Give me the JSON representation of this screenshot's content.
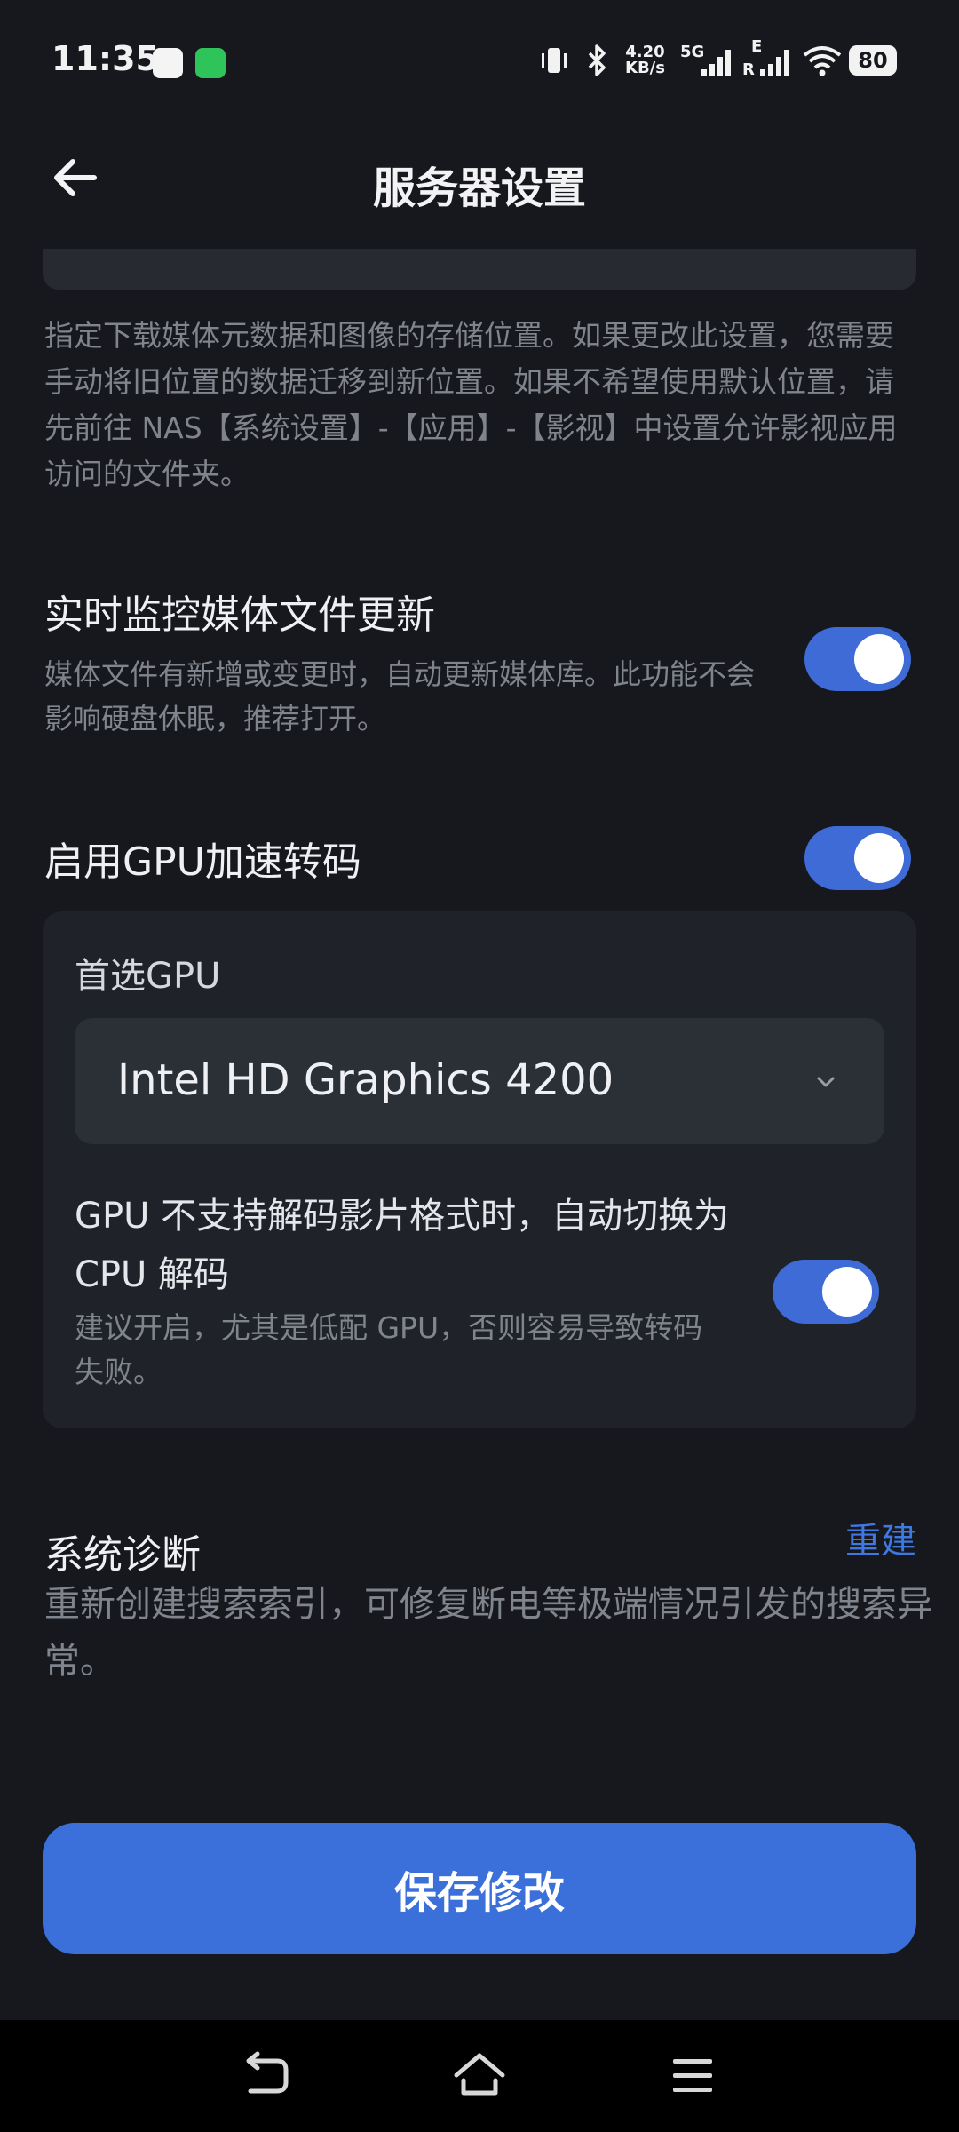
{
  "status_bar": {
    "time": "11:35",
    "net_speed_value": "4.20",
    "net_speed_unit": "KB/s",
    "network_5g": "5G",
    "network_e": "E",
    "network_r": "R",
    "battery": "80"
  },
  "header": {
    "title": "服务器设置",
    "back_icon": "arrow-left-icon"
  },
  "storage": {
    "description": "指定下载媒体元数据和图像的存储位置。如果更改此设置，您需要手动将旧位置的数据迁移到新位置。如果不希望使用默认位置，请先前往 NAS【系统设置】-【应用】-【影视】中设置允许影视应用访问的文件夹。"
  },
  "realtime_monitor": {
    "title": "实时监控媒体文件更新",
    "subtitle": "媒体文件有新增或变更时，自动更新媒体库。此功能不会影响硬盘休眠，推荐打开。",
    "enabled": true
  },
  "gpu_transcode": {
    "title": "启用GPU加速转码",
    "enabled": true,
    "preferred_label": "首选GPU",
    "preferred_value": "Intel HD Graphics 4200",
    "fallback_title": "GPU 不支持解码影片格式时，自动切换为 CPU 解码",
    "fallback_subtitle": "建议开启，尤其是低配 GPU，否则容易导致转码失败。",
    "fallback_enabled": true
  },
  "diagnostics": {
    "title": "系统诊断",
    "action": "重建",
    "subtitle": "重新创建搜索索引，可修复断电等极端情况引发的搜索异常。"
  },
  "save_button": "保存修改",
  "colors": {
    "accent": "#3b6fd9",
    "background": "#16181d",
    "link": "#3f78e0"
  }
}
